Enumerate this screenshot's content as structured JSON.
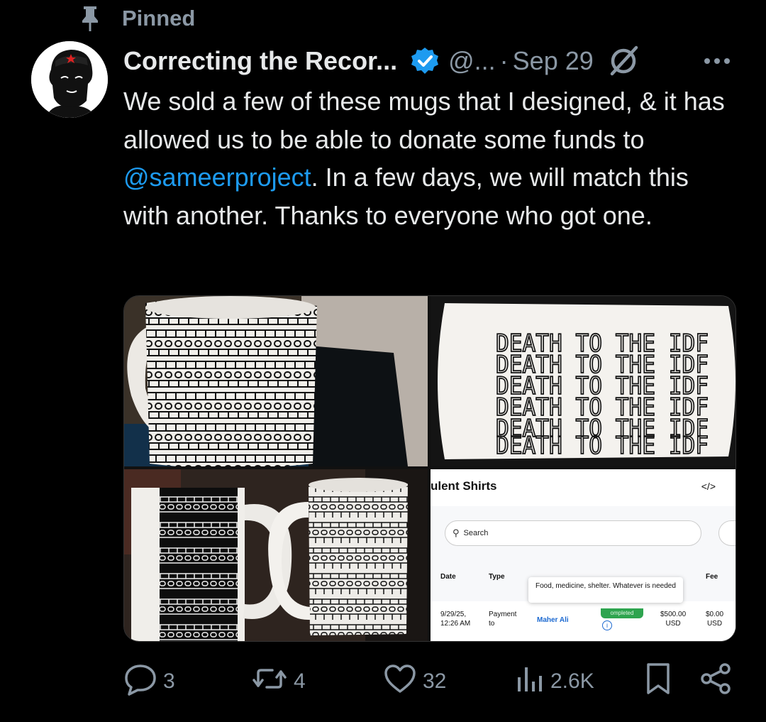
{
  "pinned_label": "Pinned",
  "author": {
    "name": "Correcting the Recor...",
    "handle": "@...",
    "separator": "·",
    "date": "Sep 29"
  },
  "post": {
    "text_before": "We sold a few of these mugs that I designed, & it has allowed us to be able to donate some funds to ",
    "mention": "@sameerproject",
    "text_after": ". In a few days, we will match this with another. Thanks to everyone who got one."
  },
  "media": {
    "mug_text": "DEATH TO THE IDF",
    "screenshot": {
      "title": "ulent Shirts",
      "code_icon": "</>",
      "search_placeholder": "Search",
      "columns": [
        "Date",
        "Type",
        "Fee"
      ],
      "tooltip": "Food, medicine, shelter. Whatever is needed",
      "row": {
        "date_line1": "9/29/25,",
        "date_line2": "12:26 AM",
        "type_line1": "Payment",
        "type_line2": "to",
        "recipient": "Maher Ali",
        "status": "ompleted",
        "amount_line1": "$500.00",
        "amount_line2": "USD",
        "fee_line1": "$0.00",
        "fee_line2": "USD"
      }
    }
  },
  "actions": {
    "replies": "3",
    "reposts": "4",
    "likes": "32",
    "views": "2.6K"
  },
  "icons": {
    "reply": "reply-icon",
    "repost": "repost-icon",
    "like": "heart-icon",
    "views": "views-icon",
    "bookmark": "bookmark-icon",
    "share": "share-icon"
  },
  "colors": {
    "background": "#000000",
    "text": "#e7e9ea",
    "muted": "#8b98a5",
    "link": "#1d9bf0"
  }
}
